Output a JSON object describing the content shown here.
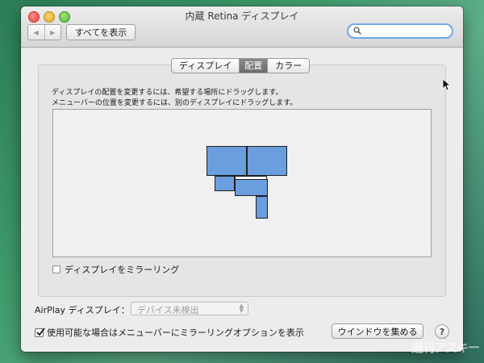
{
  "window": {
    "title": "内蔵 Retina ディスプレイ",
    "nav_back_icon": "back-arrow-icon",
    "nav_forward_icon": "forward-arrow-icon",
    "show_all_label": "すべてを表示",
    "search": {
      "placeholder": "",
      "icon": "search-icon"
    }
  },
  "tabs": [
    {
      "label": "ディスプレイ",
      "active": false
    },
    {
      "label": "配置",
      "active": true
    },
    {
      "label": "カラー",
      "active": false
    }
  ],
  "arrangement": {
    "instruction_line1": "ディスプレイの配置を変更するには、希望する場所にドラッグします。",
    "instruction_line2": "メニューバーの位置を変更するには、別のディスプレイにドラッグします。",
    "display_count": 5,
    "display_color": "#6a9edf"
  },
  "mirror": {
    "label": "ディスプレイをミラーリング",
    "checked": false
  },
  "airplay": {
    "label": "AirPlay ディスプレイ：",
    "value": "デバイス未検出",
    "enabled": false
  },
  "show_mirroring_menu": {
    "label": "使用可能な場合はメニューバーにミラーリングオプションを表示",
    "checked": true
  },
  "buttons": {
    "gather_windows": "ウインドウを集める",
    "help": "?"
  },
  "watermark": "週刊アスキー",
  "colors": {
    "accent": "#6ea7e8",
    "display_fill": "#6a9edf",
    "panel_bg": "#e5e5e5"
  }
}
